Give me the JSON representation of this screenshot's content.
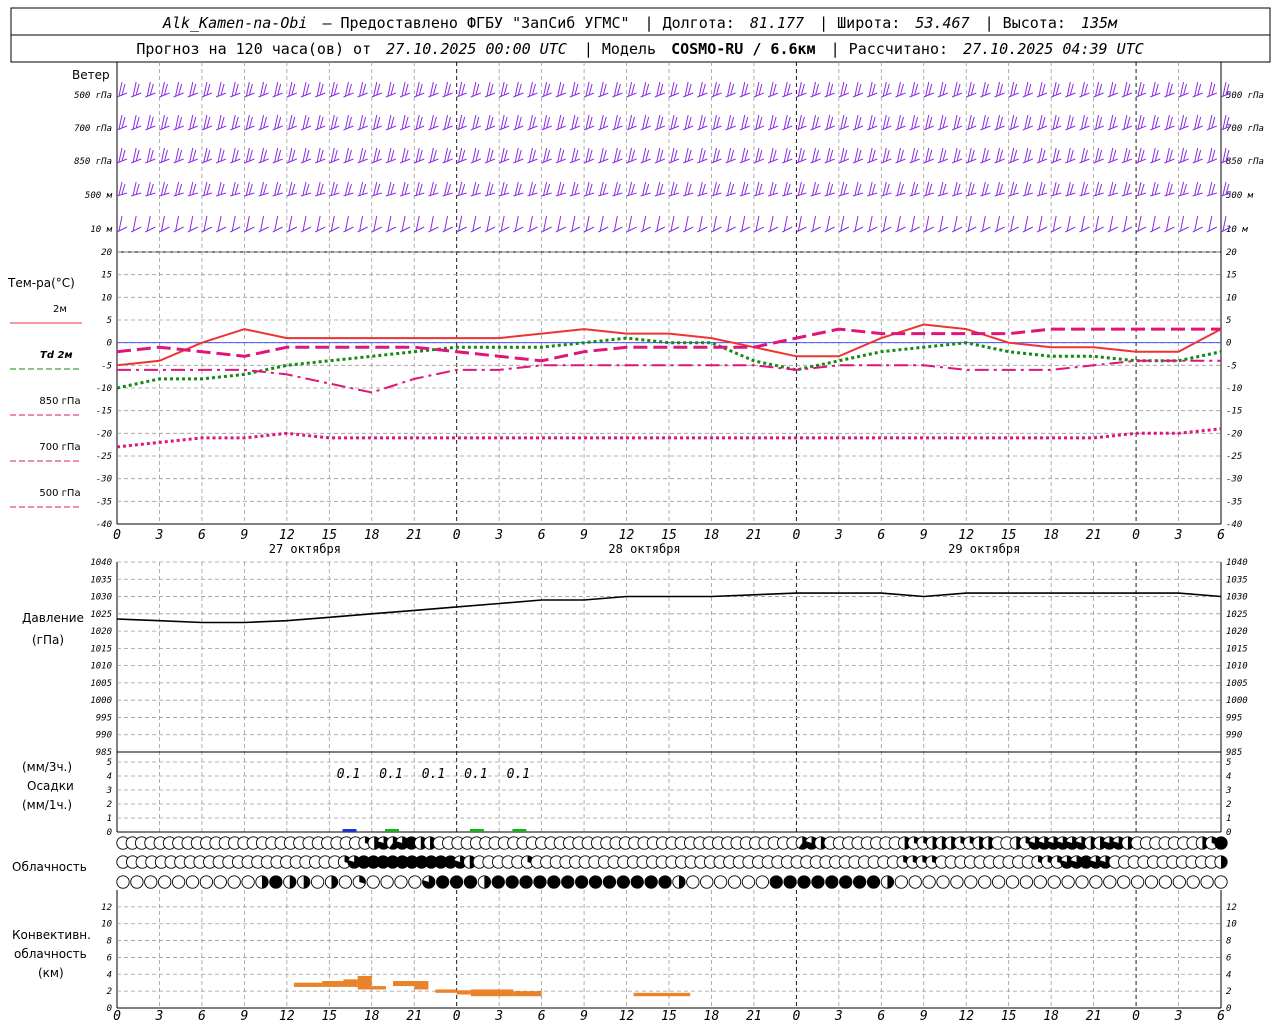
{
  "header": {
    "station": "Alk_Kamen-na-Obi",
    "provider": "– Предоставлено ФГБУ \"ЗапСиб УГМС\"",
    "lon_label": "| Долгота:",
    "lon_value": "81.177",
    "lat_label": "| Широта:",
    "lat_value": "53.467",
    "alt_label": "| Высота:",
    "alt_value": "135м",
    "forecast_label": "Прогноз на 120 часа(ов) от",
    "forecast_start": "27.10.2025 00:00 UTC",
    "model_label": "| Модель",
    "model_name": "COSMO-RU / 6.6км",
    "calc_label": "| Рассчитано:",
    "calc_time": "27.10.2025 04:39 UTC"
  },
  "panels": {
    "wind_title": "Ветер",
    "temp_title": "Тем-ра(°C)",
    "pressure_title": "Давление",
    "pressure_unit": "(гПа)",
    "precip_unit_top": "(мм/3ч.)",
    "precip_title": "Осадки",
    "precip_unit_bottom": "(мм/1ч.)",
    "cloud_title": "Облачность",
    "conv_title_1": "Конвективн.",
    "conv_title_2": "облачность",
    "conv_unit": "(км)"
  },
  "chart_data": {
    "type": "line",
    "x_hours": [
      0,
      3,
      6,
      9,
      12,
      15,
      18,
      21,
      24,
      27,
      30,
      33,
      36,
      39,
      42,
      45,
      48,
      51,
      54,
      57,
      60,
      63,
      66,
      69,
      72,
      75,
      78
    ],
    "x_tick_labels": [
      "0",
      "3",
      "6",
      "9",
      "12",
      "15",
      "18",
      "21",
      "0",
      "3",
      "6",
      "9",
      "12",
      "15",
      "18",
      "21",
      "0",
      "3",
      "6",
      "9",
      "12",
      "15",
      "18",
      "21",
      "0",
      "3",
      "6"
    ],
    "day_labels": [
      {
        "hour": 12,
        "text": "27 октября"
      },
      {
        "hour": 36,
        "text": "28 октября"
      },
      {
        "hour": 60,
        "text": "29 октября"
      }
    ],
    "midnights": [
      24,
      48,
      72
    ],
    "wind": {
      "levels": [
        "500 гПа",
        "700 гПа",
        "850 гПа",
        "500 м",
        "10 м"
      ],
      "color": "#8a2be2"
    },
    "temperature": {
      "ylim": [
        -40,
        20
      ],
      "yticks": [
        20,
        15,
        10,
        5,
        0,
        -5,
        -10,
        -15,
        -20,
        -25,
        -30,
        -35,
        -40
      ],
      "series": [
        {
          "name": "2м",
          "color": "#ee3333",
          "style": "solid",
          "hours": [
            0,
            3,
            6,
            9,
            12,
            15,
            18,
            21,
            24,
            27,
            30,
            33,
            36,
            39,
            42,
            45,
            48,
            51,
            54,
            57,
            60,
            63,
            66,
            69,
            72,
            75,
            78
          ],
          "values": [
            -5,
            -4,
            0,
            3,
            1,
            1,
            1,
            1,
            1,
            1,
            2,
            3,
            2,
            2,
            1,
            -1,
            -3,
            -3,
            1,
            4,
            3,
            0,
            -1,
            -1,
            -2,
            -2,
            3
          ]
        },
        {
          "name": "Td 2м",
          "color": "#138a13",
          "style": "dotted",
          "hours": [
            0,
            3,
            6,
            9,
            12,
            15,
            18,
            21,
            24,
            27,
            30,
            33,
            36,
            39,
            42,
            45,
            48,
            51,
            54,
            57,
            60,
            63,
            66,
            69,
            72,
            75,
            78
          ],
          "values": [
            -10,
            -8,
            -8,
            -7,
            -5,
            -4,
            -3,
            -2,
            -1,
            -1,
            -1,
            0,
            1,
            0,
            0,
            -4,
            -6,
            -4,
            -2,
            -1,
            0,
            -2,
            -3,
            -3,
            -4,
            -4,
            -2
          ]
        },
        {
          "name": "850 гПа",
          "color": "#e0157a",
          "style": "dashed",
          "hours": [
            0,
            3,
            6,
            9,
            12,
            15,
            18,
            21,
            24,
            27,
            30,
            33,
            36,
            39,
            42,
            45,
            48,
            51,
            54,
            57,
            60,
            63,
            66,
            69,
            72,
            75,
            78
          ],
          "values": [
            -2,
            -1,
            -2,
            -3,
            -1,
            -1,
            -1,
            -1,
            -2,
            -3,
            -4,
            -2,
            -1,
            -1,
            -1,
            -1,
            1,
            3,
            2,
            2,
            2,
            2,
            3,
            3,
            3,
            3,
            3
          ]
        },
        {
          "name": "700 гПа",
          "color": "#e0157a",
          "style": "dashdot",
          "hours": [
            0,
            3,
            6,
            9,
            12,
            15,
            18,
            21,
            24,
            27,
            30,
            33,
            36,
            39,
            42,
            45,
            48,
            51,
            54,
            57,
            60,
            63,
            66,
            69,
            72,
            75,
            78
          ],
          "values": [
            -6,
            -6,
            -6,
            -6,
            -7,
            -9,
            -11,
            -8,
            -6,
            -6,
            -5,
            -5,
            -5,
            -5,
            -5,
            -5,
            -6,
            -5,
            -5,
            -5,
            -6,
            -6,
            -6,
            -5,
            -4,
            -4,
            -4
          ]
        },
        {
          "name": "500 гПа",
          "color": "#e0157a",
          "style": "dotted",
          "hours": [
            0,
            3,
            6,
            9,
            12,
            15,
            18,
            21,
            24,
            27,
            30,
            33,
            36,
            39,
            42,
            45,
            48,
            51,
            54,
            57,
            60,
            63,
            66,
            69,
            72,
            75,
            78
          ],
          "values": [
            -23,
            -22,
            -21,
            -21,
            -20,
            -21,
            -21,
            -21,
            -21,
            -21,
            -21,
            -21,
            -21,
            -21,
            -21,
            -21,
            -21,
            -21,
            -21,
            -21,
            -21,
            -21,
            -21,
            -21,
            -20,
            -20,
            -19
          ]
        }
      ]
    },
    "pressure": {
      "ylim": [
        985,
        1040
      ],
      "yticks": [
        1040,
        1035,
        1030,
        1025,
        1020,
        1015,
        1010,
        1005,
        1000,
        995,
        990,
        985
      ],
      "color": "#000000",
      "hours": [
        0,
        3,
        6,
        9,
        12,
        15,
        18,
        21,
        24,
        27,
        30,
        33,
        36,
        39,
        42,
        45,
        48,
        51,
        54,
        57,
        60,
        63,
        66,
        69,
        72,
        75,
        78
      ],
      "values": [
        1023.5,
        1023,
        1022.5,
        1022.5,
        1023,
        1024,
        1025,
        1026,
        1027,
        1028,
        1029,
        1029,
        1030,
        1030,
        1030,
        1030.5,
        1031,
        1031,
        1031,
        1030,
        1031,
        1031,
        1031,
        1031,
        1031,
        1031,
        1030
      ]
    },
    "precipitation": {
      "ylim": [
        0,
        5
      ],
      "yticks": [
        5,
        4,
        3,
        2,
        1,
        0
      ],
      "labels": [
        {
          "hour": 16.5,
          "text": "0.1"
        },
        {
          "hour": 19.5,
          "text": "0.1"
        },
        {
          "hour": 22.5,
          "text": "0.1"
        },
        {
          "hour": 25.5,
          "text": "0.1"
        },
        {
          "hour": 28.5,
          "text": "0.1"
        }
      ],
      "bars": [
        {
          "hour": 16.5,
          "value": 0.1,
          "color": "#2233cc"
        },
        {
          "hour": 19.5,
          "value": 0.05,
          "color": "#22aa22"
        },
        {
          "hour": 25.5,
          "value": 0.1,
          "color": "#22aa22"
        },
        {
          "hour": 28.5,
          "value": 0.1,
          "color": "#22aa22"
        }
      ]
    },
    "cloudiness": {
      "rows": 3,
      "symbols_per_row": 79,
      "note_fraction_scale": "0 empty .. 1 full",
      "levels": [
        [
          0,
          0,
          0,
          0,
          0,
          0,
          0,
          0,
          0,
          0,
          0,
          0,
          0,
          0,
          0,
          0,
          0,
          0,
          0,
          0,
          0,
          0,
          0,
          0,
          0,
          0,
          0.3,
          0.5,
          0.8,
          0.6,
          0.8,
          1,
          0.5,
          0.5,
          0,
          0,
          0,
          0,
          0,
          0,
          0,
          0,
          0,
          0,
          0,
          0,
          0,
          0,
          0,
          0,
          0,
          0,
          0,
          0,
          0,
          0,
          0,
          0,
          0,
          0,
          0,
          0,
          0,
          0,
          0,
          0,
          0,
          0,
          0,
          0,
          0,
          0,
          0,
          0.6,
          0.8,
          0.5,
          0,
          0,
          0,
          0,
          0,
          0,
          0,
          0,
          0.5,
          0.3,
          0.3,
          0.5,
          0.5,
          0.5,
          0.3,
          0.3,
          0.5,
          0.5,
          0,
          0,
          0.5,
          0.3,
          0.8,
          0.8,
          0.8,
          0.8,
          0.8,
          0.8,
          0.5,
          0.5,
          0.8,
          0.8,
          0.5,
          0,
          0,
          0,
          0,
          0,
          0,
          0,
          0.5,
          0.3,
          1
        ],
        [
          0,
          0,
          0,
          0,
          0,
          0,
          0,
          0,
          0,
          0,
          0,
          0,
          0,
          0,
          0,
          0,
          0,
          0,
          0,
          0,
          0,
          0,
          0,
          0.3,
          0.8,
          1,
          1,
          1,
          1,
          1,
          1,
          1,
          1,
          1,
          1,
          0.8,
          0.5,
          0,
          0,
          0,
          0,
          0,
          0.3,
          0,
          0,
          0,
          0,
          0,
          0,
          0,
          0,
          0,
          0,
          0,
          0,
          0,
          0,
          0,
          0,
          0,
          0,
          0,
          0,
          0,
          0,
          0,
          0,
          0,
          0,
          0,
          0,
          0,
          0,
          0,
          0,
          0,
          0,
          0,
          0,
          0,
          0,
          0.3,
          0.3,
          0.3,
          0.3,
          0,
          0,
          0,
          0,
          0,
          0,
          0,
          0,
          0,
          0,
          0.3,
          0.3,
          0.3,
          0.8,
          0.8,
          1,
          0.8,
          0.8,
          0,
          0,
          0,
          0,
          0,
          0,
          0,
          0,
          0,
          0,
          0,
          0.5
        ],
        [
          0,
          0,
          0,
          0,
          0,
          0,
          0,
          0,
          0,
          0,
          0.5,
          1,
          0.5,
          0.5,
          0,
          0.5,
          0,
          0.3,
          0,
          0,
          0,
          0,
          0.8,
          1,
          1,
          1,
          0.5,
          1,
          1,
          1,
          1,
          1,
          1,
          1,
          1,
          1,
          1,
          1,
          1,
          1,
          0.5,
          0,
          0,
          0,
          0,
          0,
          0,
          1,
          1,
          1,
          1,
          1,
          1,
          1,
          1,
          0.5,
          0,
          0,
          0,
          0,
          0,
          0,
          0,
          0,
          0,
          0,
          0,
          0,
          0,
          0,
          0,
          0,
          0,
          0,
          0,
          0,
          0,
          0,
          0,
          0
        ]
      ]
    },
    "convective": {
      "ylim": [
        0,
        14
      ],
      "yticks": [
        12,
        10,
        8,
        6,
        4,
        2,
        0
      ],
      "color": "#e8832a",
      "segments": [
        {
          "h0": 12.5,
          "h1": 14.5,
          "base": 2.5,
          "top": 3.0
        },
        {
          "h0": 14.5,
          "h1": 16.0,
          "base": 2.5,
          "top": 3.2
        },
        {
          "h0": 16.0,
          "h1": 17.0,
          "base": 2.5,
          "top": 3.4
        },
        {
          "h0": 17.0,
          "h1": 18.0,
          "base": 2.2,
          "top": 3.8
        },
        {
          "h0": 18.0,
          "h1": 19.0,
          "base": 2.2,
          "top": 2.6
        },
        {
          "h0": 19.5,
          "h1": 21.0,
          "base": 2.6,
          "top": 3.2
        },
        {
          "h0": 21.0,
          "h1": 22.0,
          "base": 2.2,
          "top": 3.2
        },
        {
          "h0": 22.5,
          "h1": 24.0,
          "base": 1.8,
          "top": 2.2
        },
        {
          "h0": 24.0,
          "h1": 25.0,
          "base": 1.6,
          "top": 2.1
        },
        {
          "h0": 25.0,
          "h1": 28.0,
          "base": 1.4,
          "top": 2.2
        },
        {
          "h0": 28.0,
          "h1": 30.0,
          "base": 1.4,
          "top": 2.0
        },
        {
          "h0": 36.5,
          "h1": 40.5,
          "base": 1.4,
          "top": 1.8
        }
      ]
    }
  }
}
